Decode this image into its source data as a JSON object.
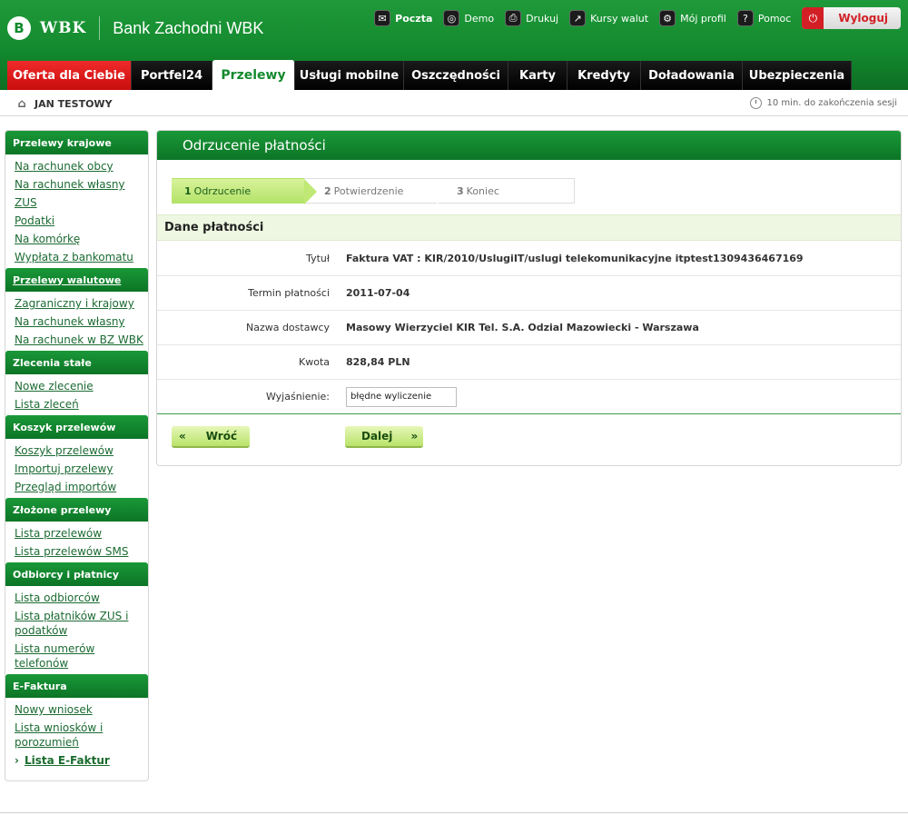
{
  "brand": {
    "logo_letter": "B",
    "logo_wordmark": "WBK",
    "bank_name": "Bank Zachodni WBK"
  },
  "toplinks": [
    {
      "label": "Poczta",
      "icon": "envelope-icon",
      "glyph": "✉"
    },
    {
      "label": "Demo",
      "icon": "demo-icon",
      "glyph": "◎"
    },
    {
      "label": "Drukuj",
      "icon": "printer-icon",
      "glyph": "⎙"
    },
    {
      "label": "Kursy walut",
      "icon": "chart-icon",
      "glyph": "↗"
    },
    {
      "label": "Mój profil",
      "icon": "gears-icon",
      "glyph": "⚙"
    },
    {
      "label": "Pomoc",
      "icon": "help-icon",
      "glyph": "?"
    }
  ],
  "logout": {
    "label": "Wyloguj",
    "glyph": "⏻"
  },
  "tabs": [
    "Oferta dla Ciebie",
    "Portfel24",
    "Przelewy",
    "Usługi mobilne",
    "Oszczędności",
    "Karty",
    "Kredyty",
    "Doładowania",
    "Ubezpieczenia"
  ],
  "user": {
    "name": "JAN TESTOWY",
    "glyph": "⌂"
  },
  "session": {
    "text": "10 min. do zakończenia sesji"
  },
  "sidebar": {
    "przelewy_krajowe": {
      "head": "Przelewy krajowe",
      "items": [
        "Na rachunek obcy",
        "Na rachunek własny",
        "ZUS",
        "Podatki",
        "Na komórkę",
        "Wypłata z bankomatu"
      ]
    },
    "przelewy_walutowe": {
      "head": "Przelewy walutowe",
      "items": [
        "Zagraniczny i krajowy",
        "Na rachunek własny",
        "Na rachunek w BZ WBK"
      ]
    },
    "zlecenia": {
      "head": "Zlecenia stałe",
      "items": [
        "Nowe zlecenie",
        "Lista zleceń"
      ]
    },
    "koszyk": {
      "head": "Koszyk przelewów",
      "items": [
        "Koszyk przelewów",
        "Importuj przelewy",
        "Przegląd importów"
      ]
    },
    "zlozone": {
      "head": "Złożone przelewy",
      "items": [
        "Lista przelewów",
        "Lista przelewów SMS"
      ]
    },
    "odbiorcy": {
      "head": "Odbiorcy i płatnicy",
      "items": [
        "Lista odbiorców",
        "Lista płatników ZUS i podatków",
        "Lista numerów telefonów"
      ]
    },
    "efaktura": {
      "head": "E-Faktura",
      "items": [
        "Nowy wniosek",
        "Lista wniosków i porozumień",
        "Lista E-Faktur"
      ]
    }
  },
  "main": {
    "title": "Odrzucenie płatności",
    "steps": [
      {
        "num": "1",
        "label": "Odrzucenie"
      },
      {
        "num": "2",
        "label": "Potwierdzenie"
      },
      {
        "num": "3",
        "label": "Koniec"
      }
    ],
    "section_title": "Dane płatności",
    "fields": [
      {
        "label": "Tytuł",
        "value": "Faktura VAT : KIR/2010/UslugiIT/uslugi telekomunikacyjne itptest1309436467169"
      },
      {
        "label": "Termin płatności",
        "value": "2011-07-04"
      },
      {
        "label": "Nazwa dostawcy",
        "value": "Masowy Wierzyciel KIR Tel. S.A. Odzial Mazowiecki - Warszawa"
      },
      {
        "label": "Kwota",
        "value": "828,84 PLN"
      }
    ],
    "explanation": {
      "label": "Wyjaśnienie:",
      "value": "błędne wyliczenie"
    },
    "back_label": "Wróć",
    "next_label": "Dalej",
    "back_glyph": "«",
    "next_glyph": "»"
  },
  "colors": {
    "brand_green": "#138a2e",
    "logout_red": "#d21f26",
    "step_active": "#b4e36a"
  }
}
